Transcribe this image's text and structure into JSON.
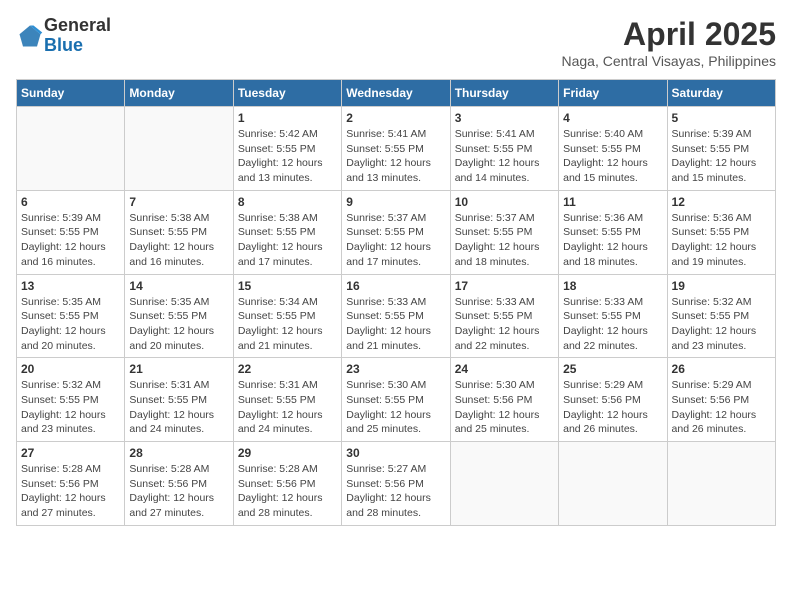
{
  "header": {
    "logo_general": "General",
    "logo_blue": "Blue",
    "month_title": "April 2025",
    "subtitle": "Naga, Central Visayas, Philippines"
  },
  "weekdays": [
    "Sunday",
    "Monday",
    "Tuesday",
    "Wednesday",
    "Thursday",
    "Friday",
    "Saturday"
  ],
  "weeks": [
    [
      {
        "day": "",
        "info": ""
      },
      {
        "day": "",
        "info": ""
      },
      {
        "day": "1",
        "info": "Sunrise: 5:42 AM\nSunset: 5:55 PM\nDaylight: 12 hours and 13 minutes."
      },
      {
        "day": "2",
        "info": "Sunrise: 5:41 AM\nSunset: 5:55 PM\nDaylight: 12 hours and 13 minutes."
      },
      {
        "day": "3",
        "info": "Sunrise: 5:41 AM\nSunset: 5:55 PM\nDaylight: 12 hours and 14 minutes."
      },
      {
        "day": "4",
        "info": "Sunrise: 5:40 AM\nSunset: 5:55 PM\nDaylight: 12 hours and 15 minutes."
      },
      {
        "day": "5",
        "info": "Sunrise: 5:39 AM\nSunset: 5:55 PM\nDaylight: 12 hours and 15 minutes."
      }
    ],
    [
      {
        "day": "6",
        "info": "Sunrise: 5:39 AM\nSunset: 5:55 PM\nDaylight: 12 hours and 16 minutes."
      },
      {
        "day": "7",
        "info": "Sunrise: 5:38 AM\nSunset: 5:55 PM\nDaylight: 12 hours and 16 minutes."
      },
      {
        "day": "8",
        "info": "Sunrise: 5:38 AM\nSunset: 5:55 PM\nDaylight: 12 hours and 17 minutes."
      },
      {
        "day": "9",
        "info": "Sunrise: 5:37 AM\nSunset: 5:55 PM\nDaylight: 12 hours and 17 minutes."
      },
      {
        "day": "10",
        "info": "Sunrise: 5:37 AM\nSunset: 5:55 PM\nDaylight: 12 hours and 18 minutes."
      },
      {
        "day": "11",
        "info": "Sunrise: 5:36 AM\nSunset: 5:55 PM\nDaylight: 12 hours and 18 minutes."
      },
      {
        "day": "12",
        "info": "Sunrise: 5:36 AM\nSunset: 5:55 PM\nDaylight: 12 hours and 19 minutes."
      }
    ],
    [
      {
        "day": "13",
        "info": "Sunrise: 5:35 AM\nSunset: 5:55 PM\nDaylight: 12 hours and 20 minutes."
      },
      {
        "day": "14",
        "info": "Sunrise: 5:35 AM\nSunset: 5:55 PM\nDaylight: 12 hours and 20 minutes."
      },
      {
        "day": "15",
        "info": "Sunrise: 5:34 AM\nSunset: 5:55 PM\nDaylight: 12 hours and 21 minutes."
      },
      {
        "day": "16",
        "info": "Sunrise: 5:33 AM\nSunset: 5:55 PM\nDaylight: 12 hours and 21 minutes."
      },
      {
        "day": "17",
        "info": "Sunrise: 5:33 AM\nSunset: 5:55 PM\nDaylight: 12 hours and 22 minutes."
      },
      {
        "day": "18",
        "info": "Sunrise: 5:33 AM\nSunset: 5:55 PM\nDaylight: 12 hours and 22 minutes."
      },
      {
        "day": "19",
        "info": "Sunrise: 5:32 AM\nSunset: 5:55 PM\nDaylight: 12 hours and 23 minutes."
      }
    ],
    [
      {
        "day": "20",
        "info": "Sunrise: 5:32 AM\nSunset: 5:55 PM\nDaylight: 12 hours and 23 minutes."
      },
      {
        "day": "21",
        "info": "Sunrise: 5:31 AM\nSunset: 5:55 PM\nDaylight: 12 hours and 24 minutes."
      },
      {
        "day": "22",
        "info": "Sunrise: 5:31 AM\nSunset: 5:55 PM\nDaylight: 12 hours and 24 minutes."
      },
      {
        "day": "23",
        "info": "Sunrise: 5:30 AM\nSunset: 5:55 PM\nDaylight: 12 hours and 25 minutes."
      },
      {
        "day": "24",
        "info": "Sunrise: 5:30 AM\nSunset: 5:56 PM\nDaylight: 12 hours and 25 minutes."
      },
      {
        "day": "25",
        "info": "Sunrise: 5:29 AM\nSunset: 5:56 PM\nDaylight: 12 hours and 26 minutes."
      },
      {
        "day": "26",
        "info": "Sunrise: 5:29 AM\nSunset: 5:56 PM\nDaylight: 12 hours and 26 minutes."
      }
    ],
    [
      {
        "day": "27",
        "info": "Sunrise: 5:28 AM\nSunset: 5:56 PM\nDaylight: 12 hours and 27 minutes."
      },
      {
        "day": "28",
        "info": "Sunrise: 5:28 AM\nSunset: 5:56 PM\nDaylight: 12 hours and 27 minutes."
      },
      {
        "day": "29",
        "info": "Sunrise: 5:28 AM\nSunset: 5:56 PM\nDaylight: 12 hours and 28 minutes."
      },
      {
        "day": "30",
        "info": "Sunrise: 5:27 AM\nSunset: 5:56 PM\nDaylight: 12 hours and 28 minutes."
      },
      {
        "day": "",
        "info": ""
      },
      {
        "day": "",
        "info": ""
      },
      {
        "day": "",
        "info": ""
      }
    ]
  ]
}
